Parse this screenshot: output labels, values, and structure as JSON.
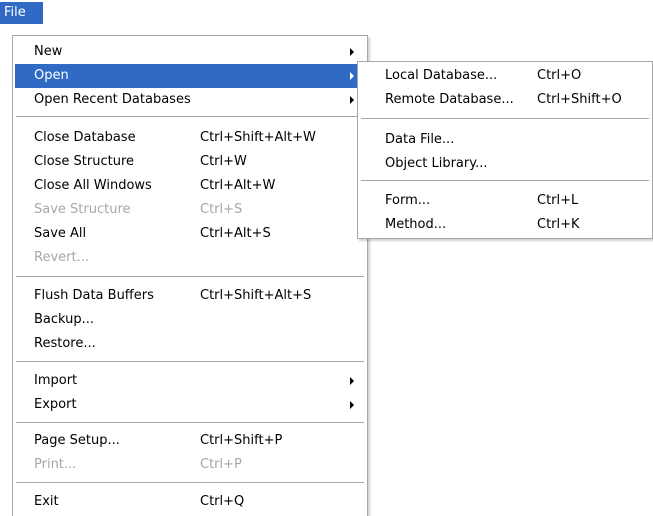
{
  "menubar": {
    "file": "File"
  },
  "main_menu": {
    "new": "New",
    "open": "Open",
    "open_recent": "Open Recent Databases",
    "close_database": {
      "label": "Close Database",
      "shortcut": "Ctrl+Shift+Alt+W"
    },
    "close_structure": {
      "label": "Close Structure",
      "shortcut": "Ctrl+W"
    },
    "close_all_windows": {
      "label": "Close All Windows",
      "shortcut": "Ctrl+Alt+W"
    },
    "save_structure": {
      "label": "Save Structure",
      "shortcut": "Ctrl+S"
    },
    "save_all": {
      "label": "Save All",
      "shortcut": "Ctrl+Alt+S"
    },
    "revert": "Revert...",
    "flush_data_buffers": {
      "label": "Flush Data Buffers",
      "shortcut": "Ctrl+Shift+Alt+S"
    },
    "backup": "Backup...",
    "restore": "Restore...",
    "import": "Import",
    "export": "Export",
    "page_setup": {
      "label": "Page Setup...",
      "shortcut": "Ctrl+Shift+P"
    },
    "print": {
      "label": "Print...",
      "shortcut": "Ctrl+P"
    },
    "exit": {
      "label": "Exit",
      "shortcut": "Ctrl+Q"
    }
  },
  "open_submenu": {
    "local_database": {
      "label": "Local Database...",
      "shortcut": "Ctrl+O"
    },
    "remote_database": {
      "label": "Remote Database...",
      "shortcut": "Ctrl+Shift+O"
    },
    "data_file": "Data File...",
    "object_library": "Object Library...",
    "form": {
      "label": "Form...",
      "shortcut": "Ctrl+L"
    },
    "method": {
      "label": "Method...",
      "shortcut": "Ctrl+K"
    }
  },
  "colors": {
    "highlight": "#316ac5",
    "disabled_text": "#a7a7a7",
    "separator": "#a7a7a7"
  },
  "icons": {
    "submenu_arrow": "chevron-right-icon"
  }
}
